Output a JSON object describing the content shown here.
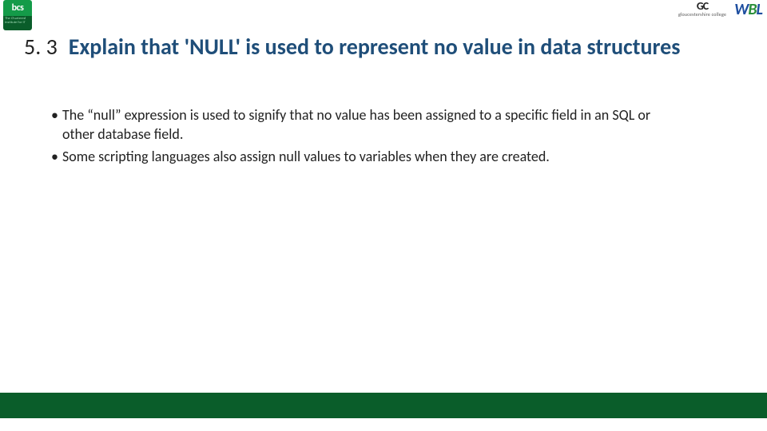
{
  "logos": {
    "bcs_label": "bcs",
    "bcs_tagline": "The Chartered Institute for IT",
    "gc_mark": "GC",
    "gc_sub": "gloucestershire college",
    "wbl_w": "W",
    "wbl_b": "B",
    "wbl_l": "L"
  },
  "section": {
    "number": "5. 3",
    "title": "Explain that 'NULL' is used to represent no value in data structures"
  },
  "bullets": [
    "The “null” expression is used to signify that no value has been assigned to a specific field in an SQL or other database field.",
    "Some scripting languages also assign null values to variables when they are created."
  ],
  "colors": {
    "title": "#1f4e79",
    "footer": "#0a5d2a",
    "badge": "#149b49"
  }
}
